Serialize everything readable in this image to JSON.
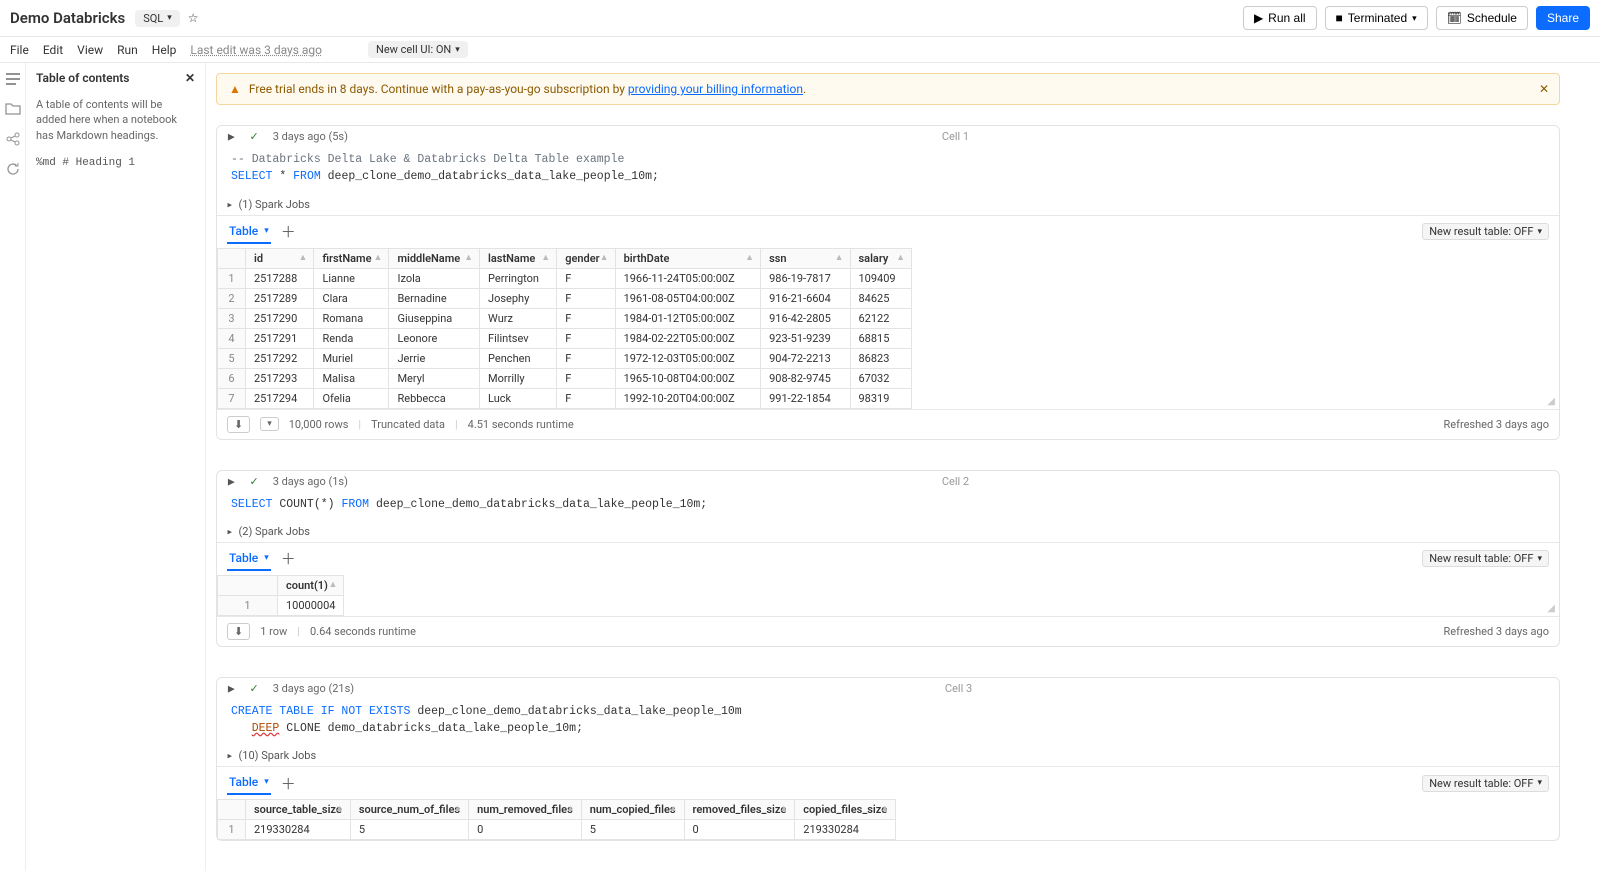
{
  "header": {
    "title": "Demo Databricks",
    "language": "SQL",
    "run_all": "Run all",
    "compute_status": "Terminated",
    "schedule": "Schedule",
    "share": "Share"
  },
  "menubar": {
    "file": "File",
    "edit": "Edit",
    "view": "View",
    "run": "Run",
    "help": "Help",
    "last_edit": "Last edit was 3 days ago",
    "new_cell_ui": "New cell UI: ON"
  },
  "toc": {
    "title": "Table of contents",
    "desc": "A table of contents will be added here when a notebook has Markdown headings.",
    "hint": "%md # Heading 1"
  },
  "alert": {
    "text_prefix": "Free trial ends in 8 days. Continue with a pay-as-you-go subscription by ",
    "link": "providing your billing information",
    "suffix": "."
  },
  "jobs": {
    "c1": "(1) Spark Jobs",
    "c2": "(2) Spark Jobs",
    "c3": "(10) Spark Jobs"
  },
  "tab_label": "Table",
  "new_result_label": "New result table: OFF",
  "cell1": {
    "name": "Cell 1",
    "time": "3 days ago (5s)",
    "code_comment": "-- Databricks Delta Lake & Databricks Delta Table example",
    "code_select": "SELECT",
    "code_star": " * ",
    "code_from": "FROM",
    "code_table": " deep_clone_demo_databricks_data_lake_people_10m;",
    "table": {
      "headers": [
        "id",
        "firstName",
        "middleName",
        "lastName",
        "gender",
        "birthDate",
        "ssn",
        "salary"
      ],
      "rows": [
        [
          "1",
          "2517288",
          "Lianne",
          "Izola",
          "Perrington",
          "F",
          "1966-11-24T05:00:00Z",
          "986-19-7817",
          "109409"
        ],
        [
          "2",
          "2517289",
          "Clara",
          "Bernadine",
          "Josephy",
          "F",
          "1961-08-05T04:00:00Z",
          "916-21-6604",
          "84625"
        ],
        [
          "3",
          "2517290",
          "Romana",
          "Giuseppina",
          "Wurz",
          "F",
          "1984-01-12T05:00:00Z",
          "916-42-2805",
          "62122"
        ],
        [
          "4",
          "2517291",
          "Renda",
          "Leonore",
          "Filintsev",
          "F",
          "1984-02-22T05:00:00Z",
          "923-51-9239",
          "68815"
        ],
        [
          "5",
          "2517292",
          "Muriel",
          "Jerrie",
          "Penchen",
          "F",
          "1972-12-03T05:00:00Z",
          "904-72-2213",
          "86823"
        ],
        [
          "6",
          "2517293",
          "Malisa",
          "Meryl",
          "Morrilly",
          "F",
          "1965-10-08T04:00:00Z",
          "908-82-9745",
          "67032"
        ],
        [
          "7",
          "2517294",
          "Ofelia",
          "Rebbecca",
          "Luck",
          "F",
          "1992-10-20T04:00:00Z",
          "991-22-1854",
          "98319"
        ]
      ]
    },
    "footer": {
      "rows": "10,000 rows",
      "trunc": "Truncated data",
      "runtime": "4.51 seconds runtime",
      "refreshed": "Refreshed 3 days ago"
    }
  },
  "cell2": {
    "name": "Cell 2",
    "time": "3 days ago (1s)",
    "code_select": "SELECT",
    "code_count": " COUNT(*) ",
    "code_from": "FROM",
    "code_table": " deep_clone_demo_databricks_data_lake_people_10m;",
    "table": {
      "headers": [
        "count(1)"
      ],
      "rows": [
        [
          "1",
          "10000004"
        ]
      ]
    },
    "footer": {
      "rows": "1 row",
      "runtime": "0.64 seconds runtime",
      "refreshed": "Refreshed 3 days ago"
    }
  },
  "cell3": {
    "name": "Cell 3",
    "time": "3 days ago (21s)",
    "code_l1a": "CREATE TABLE IF NOT EXISTS",
    "code_l1b": " deep_clone_demo_databricks_data_lake_people_10m",
    "code_l2a": "DEEP",
    "code_l2b": " CLONE demo_databricks_data_lake_people_10m;",
    "table": {
      "headers": [
        "source_table_size",
        "source_num_of_files",
        "num_removed_files",
        "num_copied_files",
        "removed_files_size",
        "copied_files_size"
      ],
      "rows": [
        [
          "1",
          "219330284",
          "5",
          "0",
          "5",
          "0",
          "219330284"
        ]
      ]
    }
  }
}
